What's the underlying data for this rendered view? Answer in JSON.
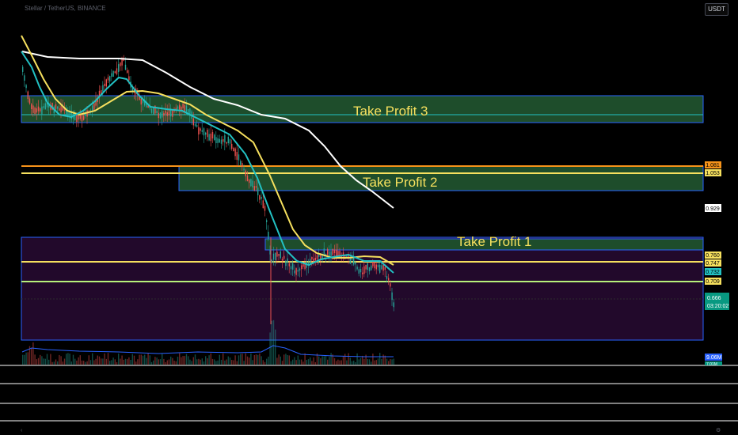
{
  "header": {
    "symbol_text": "Stellar / TetherUS, BINANCE",
    "currency": "USDT"
  },
  "zones": {
    "tp3_label": "Take Profit 3",
    "tp2_label": "Take Profit 2",
    "tp1_label": "Take Profit 1"
  },
  "price_labels": [
    {
      "id": "orange",
      "text": "1.081",
      "price": 1.081,
      "bg": "#f7931a",
      "fg": "#000000"
    },
    {
      "id": "yellow-upper",
      "text": "1.053",
      "price": 1.053,
      "bg": "#f6e05e",
      "fg": "#000000"
    },
    {
      "id": "ma-white",
      "text": "0.929",
      "price": 0.929,
      "bg": "#ffffff",
      "fg": "#000000"
    },
    {
      "id": "ma-yellow",
      "text": "0.760",
      "price": 0.76,
      "bg": "#f6e05e",
      "fg": "#000000"
    },
    {
      "id": "level-yellow",
      "text": "0.747",
      "price": 0.747,
      "bg": "#f6e05e",
      "fg": "#000000"
    },
    {
      "id": "ma-cyan",
      "text": "0.732",
      "price": 0.732,
      "bg": "#22c1c3",
      "fg": "#000000"
    },
    {
      "id": "level-green",
      "text": "0.709",
      "price": 0.709,
      "bg": "#f6e05e",
      "fg": "#000000"
    }
  ],
  "current_price": {
    "text": "0.666",
    "countdown": "03:20:02",
    "bg": "#089981"
  },
  "volume_labels": [
    {
      "text": "9.06M",
      "bg": "#2962ff"
    },
    {
      "text": "7.01M",
      "bg": "#089981"
    }
  ],
  "colors": {
    "up": "#26a69a",
    "down": "#ef5350",
    "ma_white": "#ffffff",
    "ma_yellow": "#f6e05e",
    "ma_cyan": "#22c1c3",
    "zone_green": "#1e4d2b",
    "zone_purple": "#2a0f33",
    "zone_border": "#2962ff"
  }
}
